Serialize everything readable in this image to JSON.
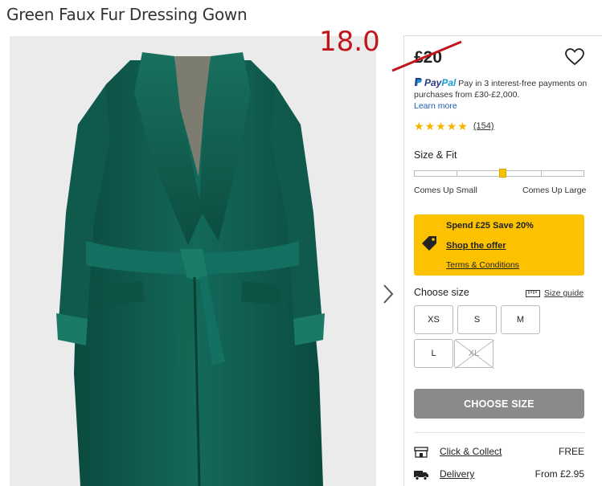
{
  "product": {
    "title": "Green Faux Fur Dressing Gown",
    "sale_price": "18.0",
    "original_price": "£20"
  },
  "paypal": {
    "brand_pay": "Pay",
    "brand_pal": "Pal",
    "text": "Pay in 3 interest-free payments on purchases from £30-£2,000.",
    "link": "Learn more"
  },
  "rating": {
    "stars": 5,
    "review_count": "(154)"
  },
  "fit": {
    "heading": "Size & Fit",
    "low_label": "Comes Up Small",
    "high_label": "Comes Up Large",
    "level": 0.52
  },
  "offer": {
    "title": "Spend £25 Save 20%",
    "link": "Shop the offer",
    "terms": "Terms & Conditions"
  },
  "sizes": {
    "heading": "Choose size",
    "guide_label": "Size guide",
    "options": [
      {
        "label": "XS",
        "available": true
      },
      {
        "label": "S",
        "available": true
      },
      {
        "label": "M",
        "available": true
      },
      {
        "label": "L",
        "available": true
      },
      {
        "label": "XL",
        "available": false
      }
    ]
  },
  "cta": {
    "label": "CHOOSE SIZE"
  },
  "delivery": [
    {
      "name": "Click & Collect",
      "cost": "FREE",
      "icon": "store-icon"
    },
    {
      "name": "Delivery",
      "cost": "From £2.95",
      "icon": "truck-icon"
    }
  ],
  "colors": {
    "accent_yellow": "#fcc200",
    "sale_red": "#c0161c",
    "gown_green": "#0f5a4c"
  }
}
